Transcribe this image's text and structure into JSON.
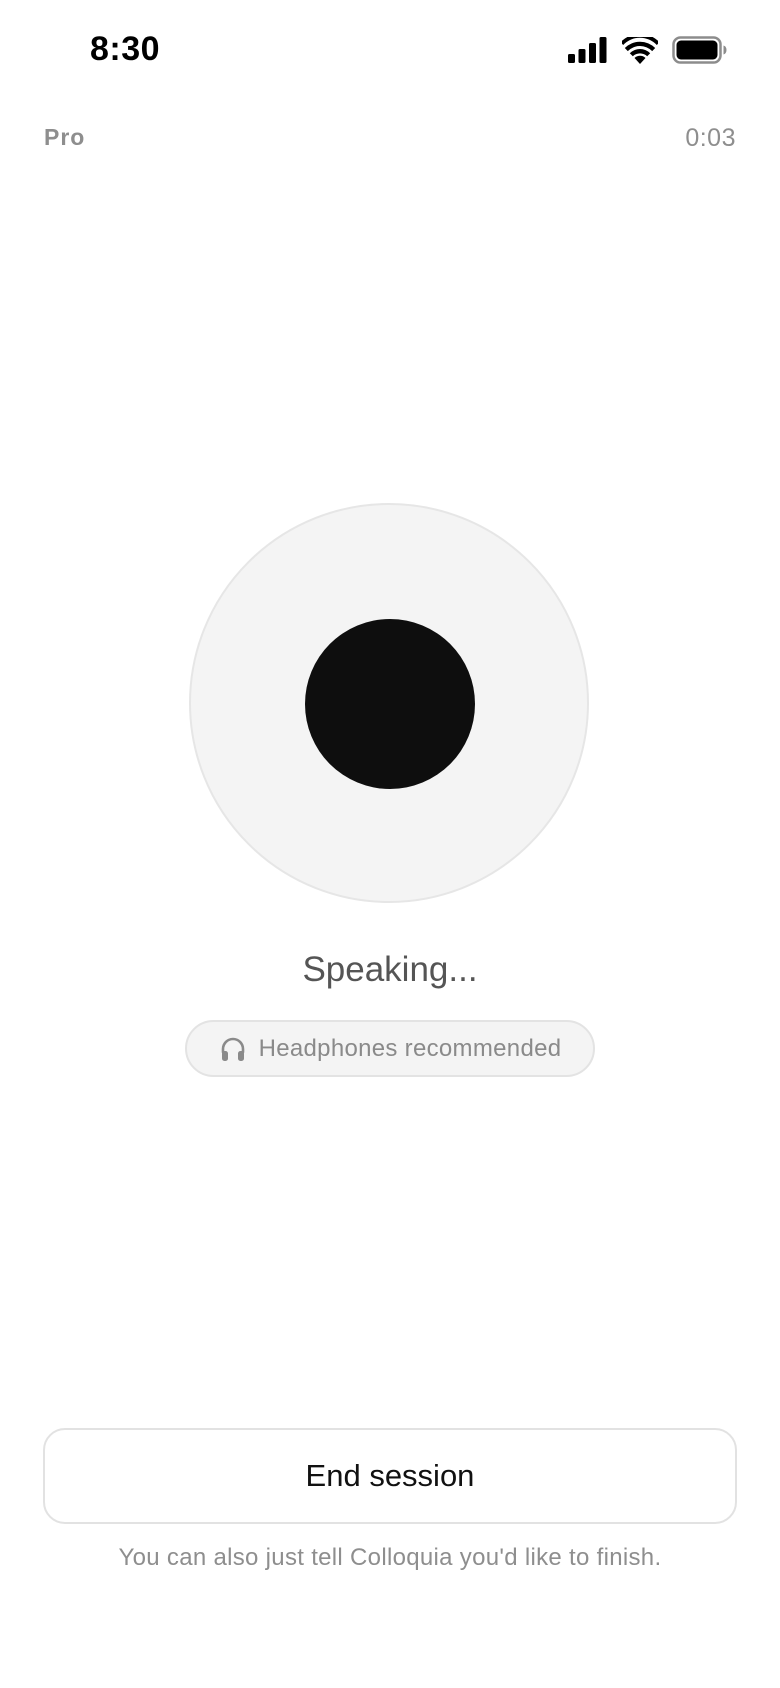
{
  "status_bar": {
    "time": "8:30",
    "icons": [
      "cellular-signal-icon",
      "wifi-icon",
      "battery-icon"
    ]
  },
  "header": {
    "plan_label": "Pro",
    "elapsed": "0:03"
  },
  "orb": {
    "state_label": "Speaking...",
    "outer_color": "#f4f4f4",
    "inner_color": "#0e0e0e"
  },
  "hint_pill": {
    "icon": "headphones-icon",
    "text": "Headphones recommended"
  },
  "actions": {
    "end_session_label": "End session",
    "footer_hint": "You can also just tell Colloquia you'd like to finish."
  }
}
